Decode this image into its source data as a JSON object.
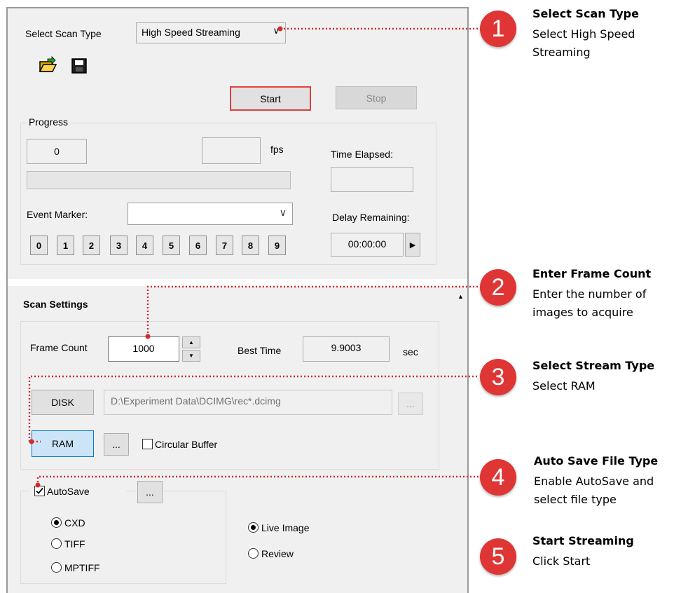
{
  "scan": {
    "select_label": "Select Scan Type",
    "scan_type": "High Speed Streaming",
    "start_label": "Start",
    "stop_label": "Stop"
  },
  "progress": {
    "group_label": "Progress",
    "frame_value": "0",
    "fps_value": "",
    "fps_unit": "fps",
    "time_elapsed_label": "Time Elapsed:",
    "time_elapsed_value": "",
    "event_marker_label": "Event Marker:",
    "event_marker_value": "",
    "marker_buttons": [
      "0",
      "1",
      "2",
      "3",
      "4",
      "5",
      "6",
      "7",
      "8",
      "9"
    ],
    "delay_label": "Delay Remaining:",
    "delay_value": "00:00:00"
  },
  "scan_settings": {
    "title": "Scan Settings",
    "frame_count_label": "Frame Count",
    "frame_count_value": "1000",
    "best_time_label": "Best Time",
    "best_time_value": "9.9003",
    "best_time_unit": "sec",
    "disk_label": "DISK",
    "disk_path": "D:\\Experiment Data\\DCIMG\\rec*.dcimg",
    "ellipsis": "...",
    "ram_label": "RAM",
    "circular_buffer_label": "Circular Buffer"
  },
  "autosave": {
    "label": "AutoSave",
    "checked": true,
    "file_types": [
      "CXD",
      "TIFF",
      "MPTIFF"
    ],
    "selected_file_type": "CXD",
    "view_options": [
      "Live Image",
      "Review"
    ],
    "selected_view": "Live Image"
  },
  "annotations": [
    {
      "number": "1",
      "title": "Select Scan Type",
      "desc": [
        "Select High Speed",
        "Streaming"
      ]
    },
    {
      "number": "2",
      "title": "Enter Frame Count",
      "desc": [
        "Enter the number of",
        "images to acquire"
      ]
    },
    {
      "number": "3",
      "title": "Select Stream Type",
      "desc": [
        "Select RAM"
      ]
    },
    {
      "number": "4",
      "title": "Auto Save File Type",
      "desc": [
        "Enable AutoSave and",
        "select file type"
      ]
    },
    {
      "number": "5",
      "title": "Start Streaming",
      "desc": [
        "Click Start"
      ]
    }
  ],
  "colors": {
    "accent_red": "#e03535",
    "highlight_border": "#e04040",
    "ram_selected": "#cce4f7"
  }
}
